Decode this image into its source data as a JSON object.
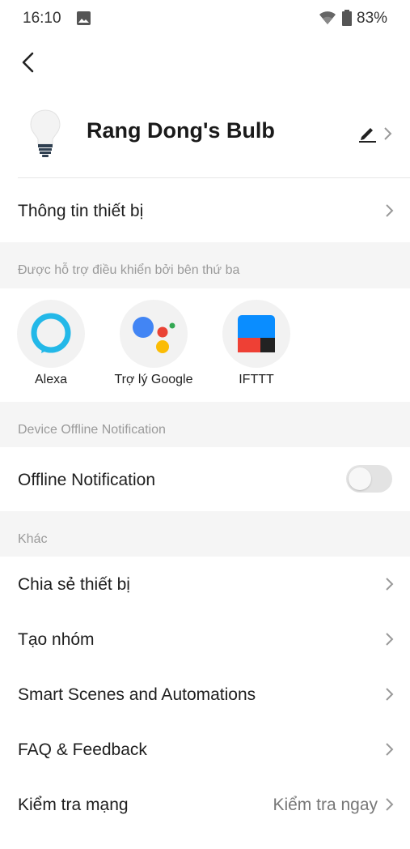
{
  "status_bar": {
    "time": "16:10",
    "battery": "83%"
  },
  "device": {
    "name": "Rang Dong's Bulb"
  },
  "rows": {
    "device_info": "Thông tin thiết bị"
  },
  "third_party": {
    "section_label": "Được hỗ trợ điều khiển bởi bên thứ ba",
    "items": [
      {
        "label": "Alexa",
        "icon": "alexa-icon"
      },
      {
        "label": "Trợ lý Google",
        "icon": "google-assistant-icon"
      },
      {
        "label": "IFTTT",
        "icon": "ifttt-icon"
      }
    ]
  },
  "offline": {
    "section_label": "Device Offline Notification",
    "label": "Offline Notification",
    "enabled": false
  },
  "other": {
    "section_label": "Khác",
    "share": "Chia sẻ thiết bị",
    "group": "Tạo nhóm",
    "scenes": "Smart Scenes and Automations",
    "faq": "FAQ & Feedback",
    "network": "Kiểm tra mạng",
    "network_action": "Kiểm tra ngay"
  },
  "colors": {
    "accent_alexa": "#23b8e8",
    "google_blue": "#4285f4",
    "google_red": "#ea4335",
    "google_yellow": "#fbbc05",
    "google_green": "#34a853",
    "ifttt_blue": "#0a8dff",
    "ifttt_red": "#ee4035",
    "ifttt_dark": "#222222"
  }
}
